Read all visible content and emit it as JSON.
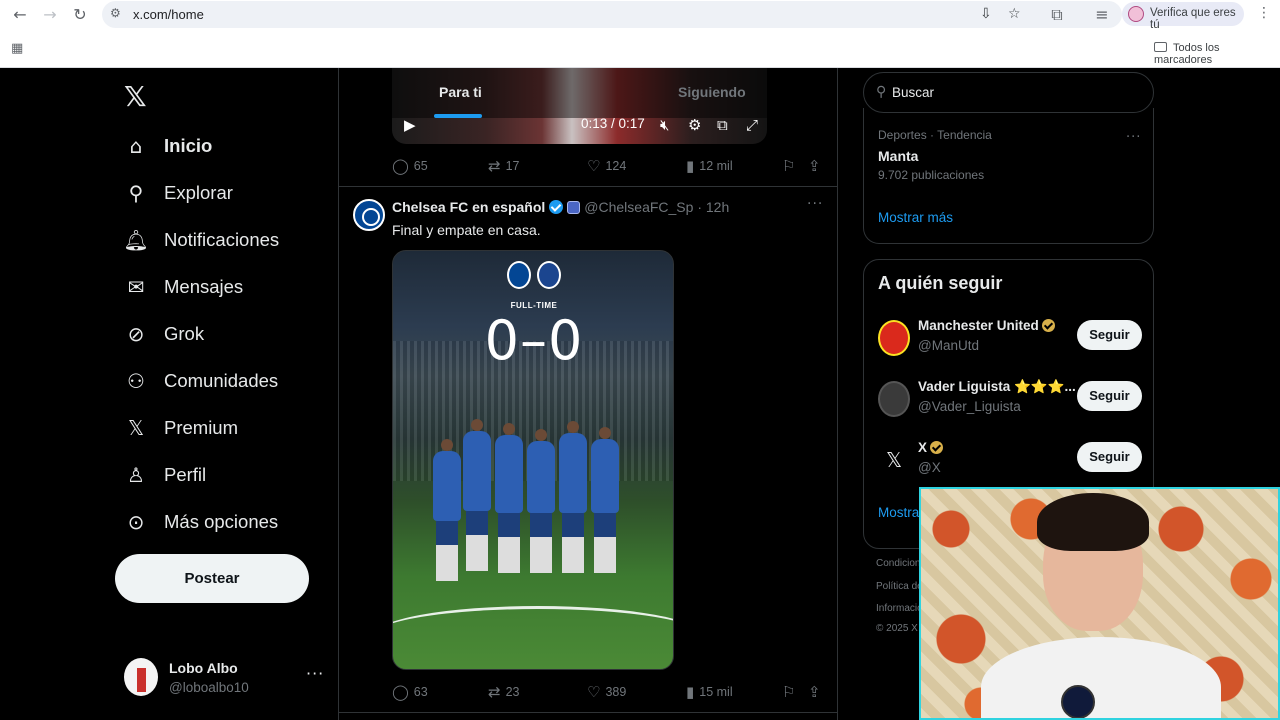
{
  "browser": {
    "url": "x.com/home",
    "verify_label": "Verifica que eres tú",
    "bookmarks_label": "Todos los marcadores"
  },
  "nav": {
    "items": [
      {
        "label": "Inicio",
        "icon": "home-icon"
      },
      {
        "label": "Explorar",
        "icon": "search-icon"
      },
      {
        "label": "Notificaciones",
        "icon": "bell-icon"
      },
      {
        "label": "Mensajes",
        "icon": "mail-icon"
      },
      {
        "label": "Grok",
        "icon": "grok-icon"
      },
      {
        "label": "Comunidades",
        "icon": "communities-icon"
      },
      {
        "label": "Premium",
        "icon": "x-logo-icon"
      },
      {
        "label": "Perfil",
        "icon": "user-icon"
      },
      {
        "label": "Más opciones",
        "icon": "more-circle-icon"
      }
    ],
    "post_label": "Postear"
  },
  "profile": {
    "name": "Lobo Albo",
    "handle": "@loboalbo10"
  },
  "feed": {
    "tabs": [
      "Para ti",
      "Siguiendo"
    ],
    "video": {
      "time": "0:13 / 0:17",
      "actions": {
        "replies": "65",
        "reposts": "17",
        "likes": "124",
        "views": "12 mil"
      }
    },
    "tweet": {
      "name": "Chelsea FC en español",
      "handle": "@ChelseaFC_Sp",
      "time": "12h",
      "text": "Final  y empate en casa.",
      "media": {
        "status": "FULL-TIME",
        "score": "0–0"
      },
      "actions": {
        "replies": "63",
        "reposts": "23",
        "likes": "389",
        "views": "15 mil"
      }
    }
  },
  "sidebar": {
    "search_placeholder": "Buscar",
    "trend": {
      "category": "Deportes · Tendencia",
      "name": "Manta",
      "count": "9.702 publicaciones"
    },
    "show_more": "Mostrar más",
    "who_to_follow": {
      "title": "A quién seguir",
      "follow_label": "Seguir",
      "accounts": [
        {
          "name": "Manchester United",
          "handle": "@ManUtd"
        },
        {
          "name": "Vader Liguista ⭐⭐⭐...",
          "handle": "@Vader_Liguista"
        },
        {
          "name": "X",
          "handle": "@X"
        }
      ],
      "show_more": "Mostrar"
    },
    "footer": [
      "Condicion",
      "Política de",
      "Informació",
      "© 2025 X"
    ]
  }
}
